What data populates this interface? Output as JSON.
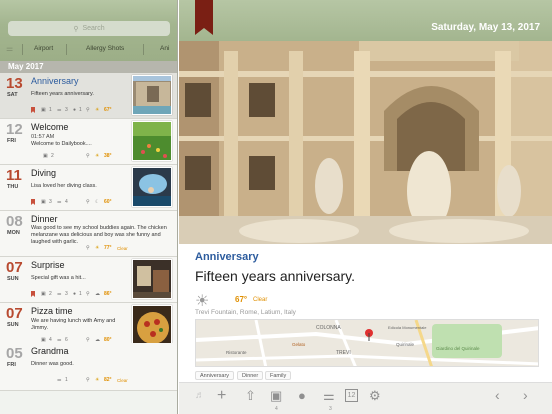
{
  "sidebar": {
    "search_placeholder": "Search",
    "tags": [
      "Airport",
      "Allergy Shots",
      "Ani"
    ],
    "month": "May 2017",
    "entries": [
      {
        "day": "13",
        "weekday": "SAT",
        "title": "Anniversary",
        "text": "Fifteen years anniversary.",
        "photos": "1",
        "tags": "3",
        "pins": "1",
        "temp": "67°"
      },
      {
        "day": "12",
        "weekday": "FRI",
        "title": "Welcome",
        "time": "01:57 AM",
        "text": "Welcome to Dailybook....",
        "photos": "2",
        "temp": "38°"
      },
      {
        "day": "11",
        "weekday": "THU",
        "title": "Diving",
        "text": "Lisa loved her diving class.",
        "photos": "3",
        "tags": "4",
        "temp": "60°"
      },
      {
        "day": "08",
        "weekday": "MON",
        "title": "Dinner",
        "text": "Was good to see my school buddies again. The chicken melanzane was delicious and boy was she funny and laughed with garlic.",
        "temp": "77°",
        "cond": "Clear"
      },
      {
        "day": "07",
        "weekday": "SUN",
        "title": "Surprise",
        "text": "Special gift was a hit...",
        "photos": "2",
        "tags": "3",
        "pins": "1",
        "temp": "86°"
      },
      {
        "day": "07",
        "weekday": "SUN",
        "title": "Pizza time",
        "text": "We are having lunch with Amy and Jimmy.",
        "photos": "4",
        "tags": "6",
        "temp": "80°"
      },
      {
        "day": "05",
        "weekday": "FRI",
        "title": "Grandma",
        "text": "Dinner was good.",
        "tags": "1",
        "temp": "82°",
        "cond": "Clear"
      }
    ]
  },
  "header": {
    "date": "Saturday, May 13, 2017"
  },
  "entry": {
    "title": "Anniversary",
    "text": "Fifteen years anniversary.",
    "temp": "67°",
    "condition": "Clear",
    "location": "Trevi Fountain, Rome, Latium, Italy",
    "map_labels": [
      "COLONNA",
      "Edicola Monumentale",
      "Quirinale",
      "TREVI",
      "Giardino del Quirinale",
      "Gelato",
      "Ristorante"
    ],
    "tags": [
      "Anniversary",
      "Dinner",
      "Family"
    ]
  },
  "toolbar": {
    "photo_count": "4",
    "tag_count": "3",
    "calendar_day": "12"
  }
}
